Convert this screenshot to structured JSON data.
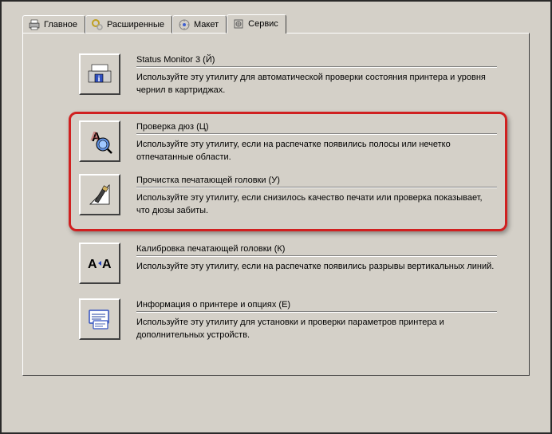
{
  "tabs": {
    "main": "Главное",
    "extended": "Расширенные",
    "layout": "Макет",
    "service": "Сервис"
  },
  "items": {
    "status": {
      "title": "Status Monitor 3 (Й)",
      "desc": "Используйте эту утилиту для автоматической проверки состояния принтера и уровня чернил в картриджах."
    },
    "nozzle": {
      "title": "Проверка дюз (Ц)",
      "desc": "Используйте эту утилиту, если на распечатке появились полосы или нечетко отпечатанные области."
    },
    "clean": {
      "title": "Прочистка печатающей головки (У)",
      "desc": "Используйте эту утилиту, если снизилось качество печати или проверка показывает, что дюзы забиты."
    },
    "align": {
      "title": "Калибровка печатающей головки (К)",
      "desc": "Используйте эту утилиту, если на распечатке появились разрывы вертикальных линий."
    },
    "info": {
      "title": "Информация о принтере и опциях (Е)",
      "desc": "Используйте эту утилиту для установки и проверки параметров принтера и дополнительных устройств."
    }
  }
}
